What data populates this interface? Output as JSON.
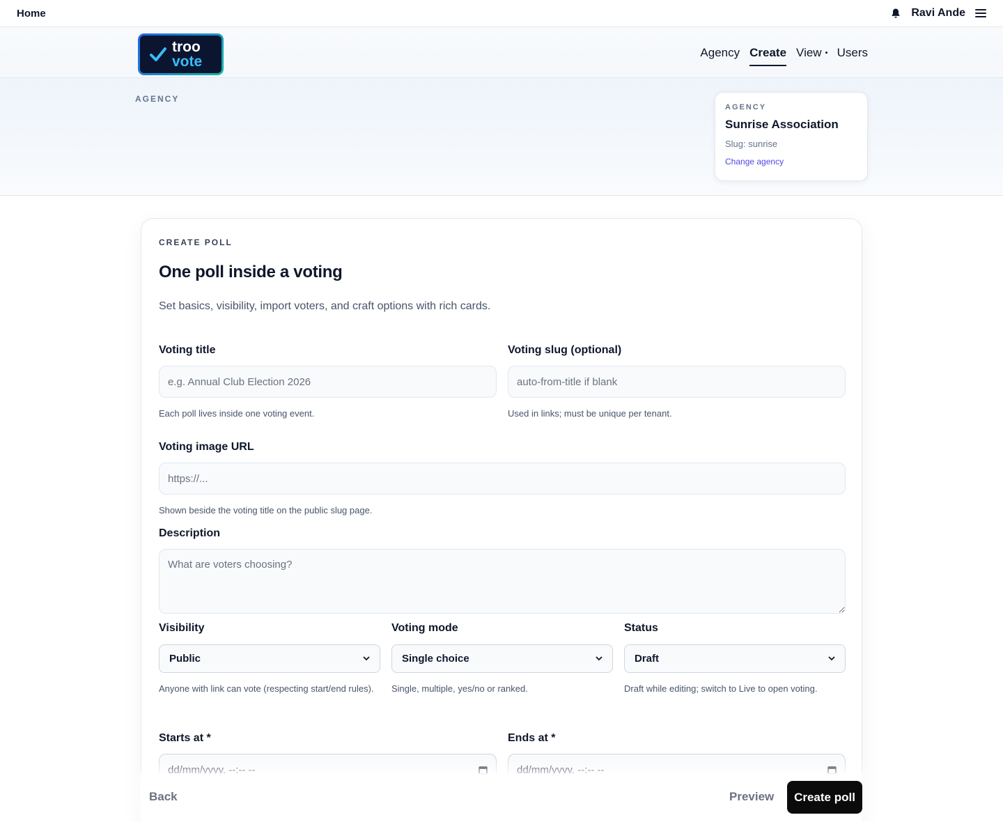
{
  "topbar": {
    "home_label": "Home",
    "user_name": "Ravi Ande"
  },
  "brand": {
    "line1": "troo",
    "line2": "vote"
  },
  "nav": {
    "items": [
      {
        "label": "Agency"
      },
      {
        "label": "Create",
        "active": true
      },
      {
        "label": "View"
      },
      {
        "label": "Users"
      }
    ]
  },
  "band": {
    "label": "AGENCY",
    "card": {
      "label": "AGENCY",
      "name": "Sunrise Association",
      "slug": "Slug: sunrise",
      "change_link": "Change agency"
    }
  },
  "form": {
    "eyebrow": "CREATE POLL",
    "title": "One poll inside a voting",
    "lead": "Set basics, visibility, import voters, and craft options with rich cards.",
    "voting_title": {
      "label": "Voting title",
      "placeholder": "e.g. Annual Club Election 2026",
      "help": "Each poll lives inside one voting event."
    },
    "voting_slug": {
      "label": "Voting slug (optional)",
      "placeholder": "auto-from-title if blank",
      "help": "Used in links; must be unique per tenant."
    },
    "image_url": {
      "label": "Voting image URL",
      "placeholder": "https://...",
      "help": "Shown beside the voting title on the public slug page."
    },
    "description": {
      "label": "Description",
      "placeholder": "What are voters choosing?"
    },
    "visibility": {
      "label": "Visibility",
      "value": "Public",
      "help": "Anyone with link can vote (respecting start/end rules)."
    },
    "mode": {
      "label": "Voting mode",
      "value": "Single choice",
      "help": "Single, multiple, yes/no or ranked."
    },
    "status": {
      "label": "Status",
      "value": "Draft",
      "help": "Draft while editing; switch to Live to open voting."
    },
    "starts": {
      "label": "Starts at *",
      "value": "dd/mm/yyyy, --:-- --"
    },
    "ends": {
      "label": "Ends at *",
      "value": "dd/mm/yyyy, --:-- --"
    }
  },
  "footer": {
    "back": "Back",
    "preview": "Preview",
    "create": "Create poll"
  },
  "colors": {
    "accent": "#4f46e5",
    "primary_button": "#0b0b0c",
    "logo_bg": "#0b1530",
    "logo_accent": "#38bdf8"
  }
}
